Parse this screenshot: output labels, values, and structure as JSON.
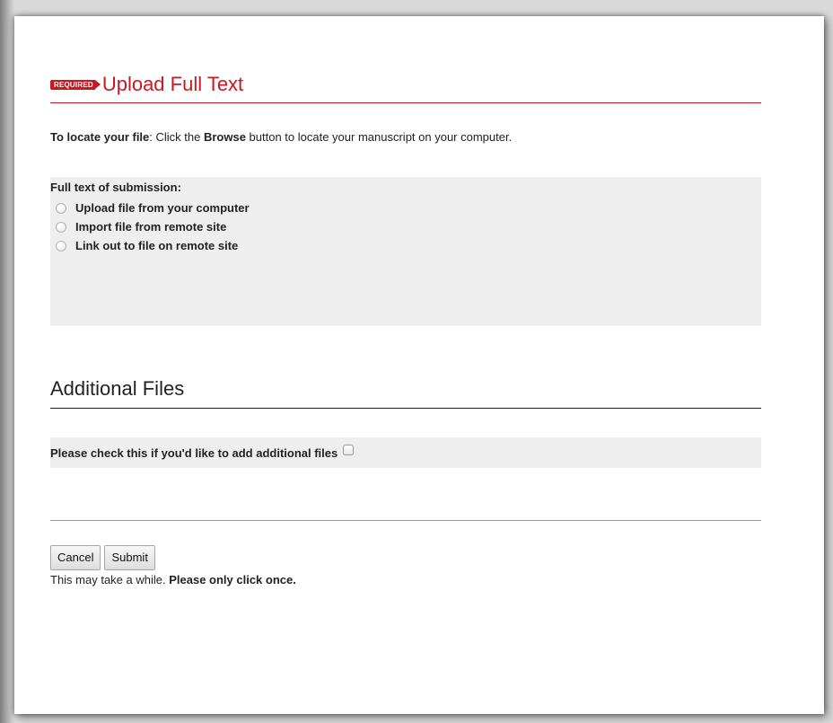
{
  "upload_section": {
    "badge": "REQUIRED",
    "title": "Upload Full Text"
  },
  "instruction": {
    "bold_prefix": "To locate your file",
    "text_before": ": Click the ",
    "bold_word": "Browse",
    "text_after": " button to locate your manuscript on your computer."
  },
  "fulltext": {
    "label": "Full text of submission:",
    "options": [
      "Upload file from your computer",
      "Import file from remote site",
      "Link out to file on remote site"
    ]
  },
  "additional": {
    "title": "Additional Files",
    "checkbox_label": "Please check this if you'd like to add additional files"
  },
  "actions": {
    "cancel_label": "Cancel",
    "submit_label": "Submit",
    "note_text": "This may take a while. ",
    "note_bold": "Please only click once."
  }
}
